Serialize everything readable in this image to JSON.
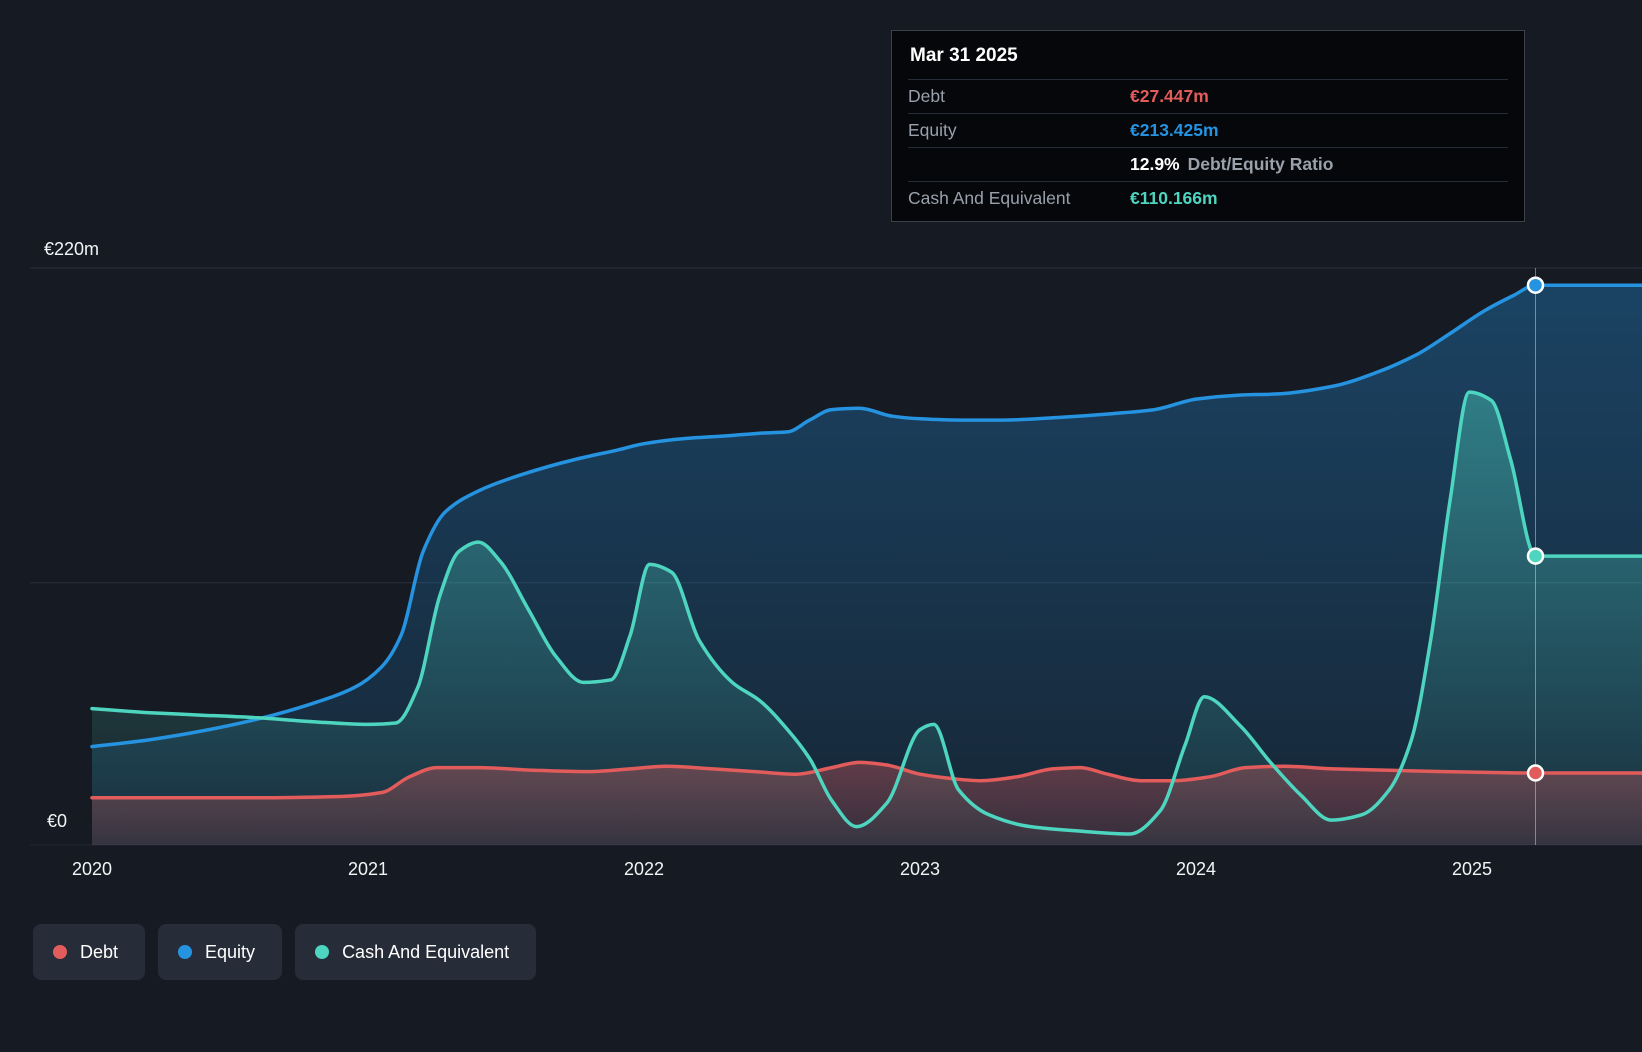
{
  "colors": {
    "debt": "#e25c5c",
    "equity": "#2593e0",
    "cash": "#4ed5c0",
    "background": "#151a23",
    "gridline": "#2a313c"
  },
  "tooltip": {
    "date": "Mar 31 2025",
    "debt_label": "Debt",
    "debt_value": "€27.447m",
    "equity_label": "Equity",
    "equity_value": "€213.425m",
    "ratio_percent": "12.9%",
    "ratio_label": "Debt/Equity Ratio",
    "cash_label": "Cash And Equivalent",
    "cash_value": "€110.166m"
  },
  "y_axis": {
    "top_label": "€220m",
    "bottom_label": "€0"
  },
  "x_axis": {
    "ticks": [
      "2020",
      "2021",
      "2022",
      "2023",
      "2024",
      "2025"
    ]
  },
  "legend": [
    {
      "label": "Debt",
      "series": "debt"
    },
    {
      "label": "Equity",
      "series": "equity"
    },
    {
      "label": "Cash And Equivalent",
      "series": "cash"
    }
  ],
  "chart_data": {
    "type": "area",
    "x_unit": "year",
    "y_unit": "EUR millions",
    "xlim": [
      2020,
      2025.23
    ],
    "ylim": [
      0,
      220
    ],
    "gridline_values": [
      220,
      100
    ],
    "grid": "horizontal",
    "legend_position": "bottom-left",
    "crosshair_x": 2025.23,
    "crosshair_date": "Mar 31 2025",
    "series": [
      {
        "name": "Equity",
        "color": "#2593e0",
        "end_value": 213.425,
        "points": [
          [
            2020.0,
            37.5
          ],
          [
            2020.2,
            40
          ],
          [
            2020.4,
            43.5
          ],
          [
            2020.6,
            48
          ],
          [
            2020.8,
            54
          ],
          [
            2020.95,
            60
          ],
          [
            2021.05,
            68
          ],
          [
            2021.12,
            80
          ],
          [
            2021.2,
            112
          ],
          [
            2021.28,
            127
          ],
          [
            2021.4,
            135
          ],
          [
            2021.55,
            141
          ],
          [
            2021.75,
            147
          ],
          [
            2021.9,
            150.5
          ],
          [
            2022.0,
            153
          ],
          [
            2022.15,
            155
          ],
          [
            2022.3,
            156
          ],
          [
            2022.42,
            157
          ],
          [
            2022.52,
            157.5
          ],
          [
            2022.6,
            162
          ],
          [
            2022.68,
            166
          ],
          [
            2022.78,
            166.5
          ],
          [
            2022.9,
            163.5
          ],
          [
            2023.0,
            162.5
          ],
          [
            2023.15,
            162
          ],
          [
            2023.3,
            162
          ],
          [
            2023.5,
            163
          ],
          [
            2023.7,
            164.5
          ],
          [
            2023.85,
            166
          ],
          [
            2024.0,
            170
          ],
          [
            2024.15,
            171.5
          ],
          [
            2024.3,
            172
          ],
          [
            2024.5,
            175
          ],
          [
            2024.65,
            180
          ],
          [
            2024.8,
            187
          ],
          [
            2024.92,
            195
          ],
          [
            2025.05,
            204
          ],
          [
            2025.15,
            209.5
          ],
          [
            2025.23,
            213.425
          ]
        ]
      },
      {
        "name": "Cash And Equivalent",
        "color": "#4ed5c0",
        "end_value": 110.166,
        "points": [
          [
            2020.0,
            52
          ],
          [
            2020.2,
            50.5
          ],
          [
            2020.4,
            49.5
          ],
          [
            2020.6,
            48.5
          ],
          [
            2020.8,
            47
          ],
          [
            2021.0,
            46
          ],
          [
            2021.1,
            46.5
          ],
          [
            2021.18,
            60
          ],
          [
            2021.26,
            95
          ],
          [
            2021.33,
            112
          ],
          [
            2021.4,
            115.5
          ],
          [
            2021.48,
            108
          ],
          [
            2021.58,
            90
          ],
          [
            2021.68,
            72
          ],
          [
            2021.78,
            62
          ],
          [
            2021.88,
            63
          ],
          [
            2021.95,
            80
          ],
          [
            2022.02,
            107
          ],
          [
            2022.1,
            104
          ],
          [
            2022.2,
            78
          ],
          [
            2022.32,
            62
          ],
          [
            2022.42,
            55
          ],
          [
            2022.52,
            44
          ],
          [
            2022.6,
            33
          ],
          [
            2022.68,
            17
          ],
          [
            2022.77,
            7
          ],
          [
            2022.88,
            16
          ],
          [
            2023.0,
            44
          ],
          [
            2023.05,
            46
          ],
          [
            2023.14,
            21
          ],
          [
            2023.25,
            11.5
          ],
          [
            2023.4,
            7
          ],
          [
            2023.58,
            5.3
          ],
          [
            2023.76,
            4.2
          ],
          [
            2023.87,
            13
          ],
          [
            2023.96,
            38
          ],
          [
            2024.03,
            56.5
          ],
          [
            2024.16,
            45.5
          ],
          [
            2024.27,
            31.5
          ],
          [
            2024.38,
            19
          ],
          [
            2024.49,
            9.5
          ],
          [
            2024.6,
            11.5
          ],
          [
            2024.7,
            21
          ],
          [
            2024.78,
            40
          ],
          [
            2024.85,
            78
          ],
          [
            2024.92,
            131
          ],
          [
            2024.99,
            172.7
          ],
          [
            2025.07,
            169.5
          ],
          [
            2025.14,
            147
          ],
          [
            2025.23,
            110.166
          ]
        ]
      },
      {
        "name": "Debt",
        "color": "#e25c5c",
        "end_value": 27.447,
        "points": [
          [
            2020.0,
            18
          ],
          [
            2020.3,
            18
          ],
          [
            2020.6,
            18
          ],
          [
            2020.9,
            18.5
          ],
          [
            2021.05,
            20
          ],
          [
            2021.15,
            26
          ],
          [
            2021.25,
            29.5
          ],
          [
            2021.4,
            29.5
          ],
          [
            2021.6,
            28.5
          ],
          [
            2021.8,
            28
          ],
          [
            2021.95,
            29
          ],
          [
            2022.08,
            30
          ],
          [
            2022.25,
            29
          ],
          [
            2022.4,
            28
          ],
          [
            2022.55,
            27
          ],
          [
            2022.68,
            29.5
          ],
          [
            2022.78,
            31.5
          ],
          [
            2022.88,
            30.5
          ],
          [
            2023.0,
            27
          ],
          [
            2023.1,
            25.5
          ],
          [
            2023.22,
            24.5
          ],
          [
            2023.35,
            26
          ],
          [
            2023.48,
            29
          ],
          [
            2023.58,
            29.5
          ],
          [
            2023.68,
            27
          ],
          [
            2023.8,
            24.5
          ],
          [
            2023.92,
            24.5
          ],
          [
            2024.05,
            26
          ],
          [
            2024.18,
            29.5
          ],
          [
            2024.32,
            30
          ],
          [
            2024.5,
            29
          ],
          [
            2024.7,
            28.5
          ],
          [
            2024.9,
            28
          ],
          [
            2025.1,
            27.6
          ],
          [
            2025.23,
            27.447
          ]
        ]
      }
    ]
  }
}
